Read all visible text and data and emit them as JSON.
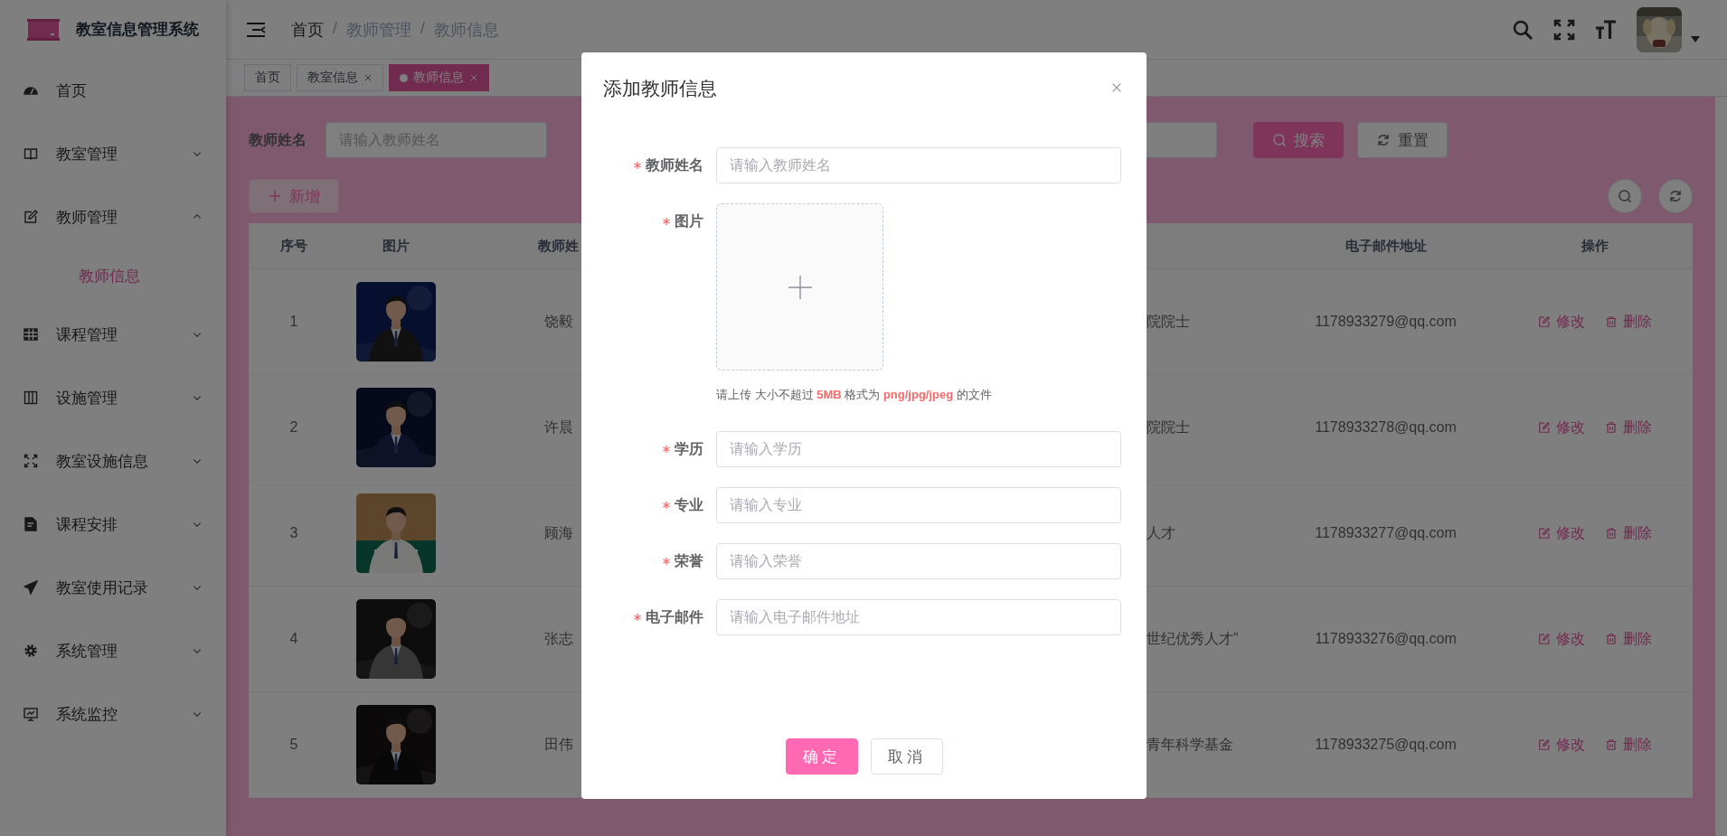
{
  "app": {
    "title": "教室信息管理系统"
  },
  "sidebar": {
    "items": [
      {
        "label": "首页",
        "kind": "link",
        "selected": false
      },
      {
        "label": "教室管理",
        "kind": "submenu",
        "expanded": false
      },
      {
        "label": "教师管理",
        "kind": "submenu",
        "expanded": true,
        "children": [
          {
            "label": "教师信息",
            "selected": true
          }
        ]
      },
      {
        "label": "课程管理",
        "kind": "submenu",
        "expanded": false
      },
      {
        "label": "设施管理",
        "kind": "submenu",
        "expanded": false
      },
      {
        "label": "教室设施信息",
        "kind": "submenu",
        "expanded": false
      },
      {
        "label": "课程安排",
        "kind": "submenu",
        "expanded": false
      },
      {
        "label": "教室使用记录",
        "kind": "submenu",
        "expanded": false
      },
      {
        "label": "系统管理",
        "kind": "submenu",
        "expanded": false
      },
      {
        "label": "系统监控",
        "kind": "submenu",
        "expanded": false
      }
    ]
  },
  "breadcrumb": [
    {
      "label": "首页",
      "kind": "crumb",
      "current": false
    },
    {
      "label": "/",
      "kind": "separator"
    },
    {
      "label": "教师管理",
      "kind": "crumb",
      "current": true
    },
    {
      "label": "/",
      "kind": "separator"
    },
    {
      "label": "教师信息",
      "kind": "crumb",
      "current": true
    }
  ],
  "tags": [
    {
      "label": "首页",
      "closable": false,
      "selected": false
    },
    {
      "label": "教室信息",
      "closable": true,
      "selected": false
    },
    {
      "label": "教师信息",
      "closable": true,
      "selected": true
    }
  ],
  "search": {
    "label": "教师姓名",
    "placeholder": "请输入教师姓名",
    "buttons": [
      {
        "label": "搜索",
        "kind": "primary"
      },
      {
        "label": "重置",
        "kind": "default"
      }
    ]
  },
  "toolbar": {
    "add_button": "新增"
  },
  "table": {
    "columns": [
      {
        "label": "序号"
      },
      {
        "label": "图片"
      },
      {
        "label": "教师姓"
      },
      {
        "label": "电子邮件地址"
      },
      {
        "label": "操作"
      }
    ],
    "rows": [
      {
        "index": "1",
        "name": "饶毅",
        "column_4": "院院士",
        "email": "1178933279@qq.com",
        "actions": [
          "修改",
          "删除"
        ]
      },
      {
        "index": "2",
        "name": "许晨",
        "column_4": "院院士",
        "email": "1178933278@qq.com",
        "actions": [
          "修改",
          "删除"
        ]
      },
      {
        "index": "3",
        "name": "顾海",
        "column_4": "人才",
        "email": "1178933277@qq.com",
        "actions": [
          "修改",
          "删除"
        ]
      },
      {
        "index": "4",
        "name": "张志",
        "column_4": "世纪优秀人才”",
        "email": "1178933276@qq.com",
        "actions": [
          "修改",
          "删除"
        ]
      },
      {
        "index": "5",
        "name": "田伟",
        "column_4": "青年科学基金",
        "email": "1178933275@qq.com",
        "actions": [
          "修改",
          "删除"
        ]
      }
    ]
  },
  "dialog": {
    "title": "添加教师信息",
    "fields": [
      {
        "label": "教师姓名",
        "required": true,
        "kind": "text",
        "placeholder": "请输入教师姓名"
      },
      {
        "label": "图片",
        "required": true,
        "kind": "upload",
        "hint": "请上传 大小不超过 **5MB** 格式为 **png/jpg/jpeg** 的文件"
      },
      {
        "label": "学历",
        "required": true,
        "kind": "text",
        "placeholder": "请输入学历"
      },
      {
        "label": "专业",
        "required": true,
        "kind": "text",
        "placeholder": "请输入专业"
      },
      {
        "label": "荣誉",
        "required": true,
        "kind": "text",
        "placeholder": "请输入荣誉"
      },
      {
        "label": "电子邮件",
        "required": true,
        "kind": "text",
        "placeholder": "请输入电子邮件地址"
      }
    ],
    "buttons": [
      {
        "label": "确定",
        "kind": "primary"
      },
      {
        "label": "取消",
        "kind": "default"
      }
    ]
  }
}
